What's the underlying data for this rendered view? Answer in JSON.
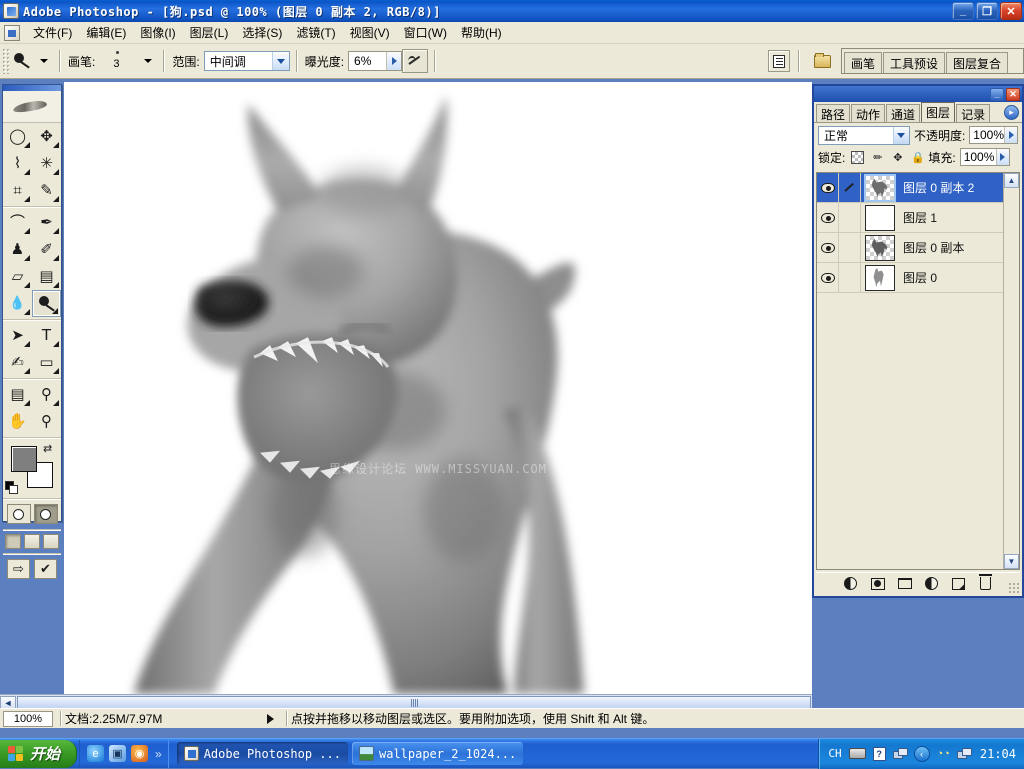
{
  "window": {
    "title": "Adobe Photoshop - [狗.psd @ 100% (图层 0 副本 2, RGB/8)]",
    "minimize_label": "_",
    "restore_label": "❐",
    "close_label": "✕"
  },
  "menubar": {
    "items": [
      {
        "label": "文件(F)"
      },
      {
        "label": "编辑(E)"
      },
      {
        "label": "图像(I)"
      },
      {
        "label": "图层(L)"
      },
      {
        "label": "选择(S)"
      },
      {
        "label": "滤镜(T)"
      },
      {
        "label": "视图(V)"
      },
      {
        "label": "窗口(W)"
      },
      {
        "label": "帮助(H)"
      }
    ]
  },
  "options_bar": {
    "brush_label": "画笔:",
    "brush_size": "3",
    "range_label": "范围:",
    "range_value": "中间调",
    "exposure_label": "曝光度:",
    "exposure_value": "6%",
    "well_tabs": [
      "画笔",
      "工具预设",
      "图层复合"
    ]
  },
  "toolbox": {
    "tools": [
      {
        "name": "marquee-tool",
        "glyph": "◯"
      },
      {
        "name": "move-tool",
        "glyph": "✥"
      },
      {
        "name": "lasso-tool",
        "glyph": "⌇"
      },
      {
        "name": "magic-wand-tool",
        "glyph": "✳"
      },
      {
        "name": "crop-tool",
        "glyph": "⌗"
      },
      {
        "name": "slice-tool",
        "glyph": "✎"
      },
      {
        "name": "healing-brush-tool",
        "glyph": "⌒"
      },
      {
        "name": "brush-tool",
        "glyph": "✒"
      },
      {
        "name": "clone-stamp-tool",
        "glyph": "♟"
      },
      {
        "name": "history-brush-tool",
        "glyph": "✐"
      },
      {
        "name": "eraser-tool",
        "glyph": "▱"
      },
      {
        "name": "gradient-tool",
        "glyph": "▤"
      },
      {
        "name": "blur-tool",
        "glyph": "💧"
      },
      {
        "name": "dodge-tool",
        "glyph": "◕"
      },
      {
        "name": "path-selection-tool",
        "glyph": "➤"
      },
      {
        "name": "type-tool",
        "glyph": "T"
      },
      {
        "name": "pen-tool",
        "glyph": "✍"
      },
      {
        "name": "shape-tool",
        "glyph": "▭"
      },
      {
        "name": "notes-tool",
        "glyph": "▤"
      },
      {
        "name": "eyedropper-tool",
        "glyph": "⚲"
      },
      {
        "name": "hand-tool",
        "glyph": "✋"
      },
      {
        "name": "zoom-tool",
        "glyph": "⚲"
      }
    ],
    "selected_tool": "dodge-tool",
    "foreground_color": "#7f7f7f",
    "background_color": "#ffffff",
    "swap_glyph": "⇄",
    "quickmask_glyphs": [
      "◯",
      "◯"
    ],
    "screenmode_count": 3,
    "imageready_glyph": "⇨"
  },
  "canvas": {
    "watermark": "思缘设计论坛 WWW.MISSYUAN.COM",
    "scroll_left_glyph": "◄"
  },
  "status_bar": {
    "zoom": "100%",
    "doc_info": "文档:2.25M/7.97M",
    "hint": "点按并拖移以移动图层或选区。要用附加选项，使用 Shift 和 Alt 键。"
  },
  "layers_palette": {
    "minimize_label": "_",
    "close_label": "✕",
    "tabs": [
      {
        "label": "路径",
        "active": false
      },
      {
        "label": "动作",
        "active": false
      },
      {
        "label": "通道",
        "active": false
      },
      {
        "label": "图层",
        "active": true
      },
      {
        "label": "记录",
        "active": false
      }
    ],
    "menu_glyph": "▸",
    "blend_mode": "正常",
    "opacity_label": "不透明度:",
    "opacity_value": "100%",
    "lock_label": "锁定:",
    "lock_icons": [
      "transparency-lock",
      "paint-lock",
      "move-lock",
      "all-lock"
    ],
    "fill_label": "填充:",
    "fill_value": "100%",
    "layers": [
      {
        "name": "图层 0 副本 2",
        "selected": true,
        "visible": true,
        "linked": true,
        "thumb": "dog",
        "transparent": true
      },
      {
        "name": "图层 1",
        "selected": false,
        "visible": true,
        "linked": false,
        "thumb": "blank",
        "transparent": false
      },
      {
        "name": "图层 0 副本",
        "selected": false,
        "visible": true,
        "linked": false,
        "thumb": "dog",
        "transparent": true
      },
      {
        "name": "图层 0",
        "selected": false,
        "visible": true,
        "linked": false,
        "thumb": "silhouette",
        "transparent": false
      }
    ],
    "scroll_up_glyph": "▲",
    "scroll_down_glyph": "▼",
    "footer_buttons": [
      {
        "name": "layer-style-button",
        "glyph": "◐"
      },
      {
        "name": "layer-mask-button",
        "glyph": "◻"
      },
      {
        "name": "new-group-button",
        "glyph": "▭"
      },
      {
        "name": "adjustment-layer-button",
        "glyph": "◑"
      },
      {
        "name": "new-layer-button",
        "glyph": "▣"
      },
      {
        "name": "delete-layer-button",
        "glyph": "🗑"
      }
    ]
  },
  "taskbar": {
    "start_label": "开始",
    "quick_launch": [
      {
        "name": "internet-explorer-icon",
        "glyph": "e"
      },
      {
        "name": "show-desktop-icon",
        "glyph": "▣"
      },
      {
        "name": "firefox-icon",
        "glyph": "◉"
      }
    ],
    "quick_more_glyph": "»",
    "tasks": [
      {
        "label": "Adobe Photoshop ...",
        "active": true,
        "icon": "photoshop-icon"
      },
      {
        "label": "wallpaper_2_1024...",
        "active": false,
        "icon": "image-icon"
      }
    ],
    "tray": {
      "input_method": "CH",
      "icons": [
        "keyboard-icon",
        "help-icon",
        "network-icon"
      ],
      "chevron_glyph": "‹",
      "extra_glyph": "◔◔",
      "time": "21:04"
    }
  }
}
